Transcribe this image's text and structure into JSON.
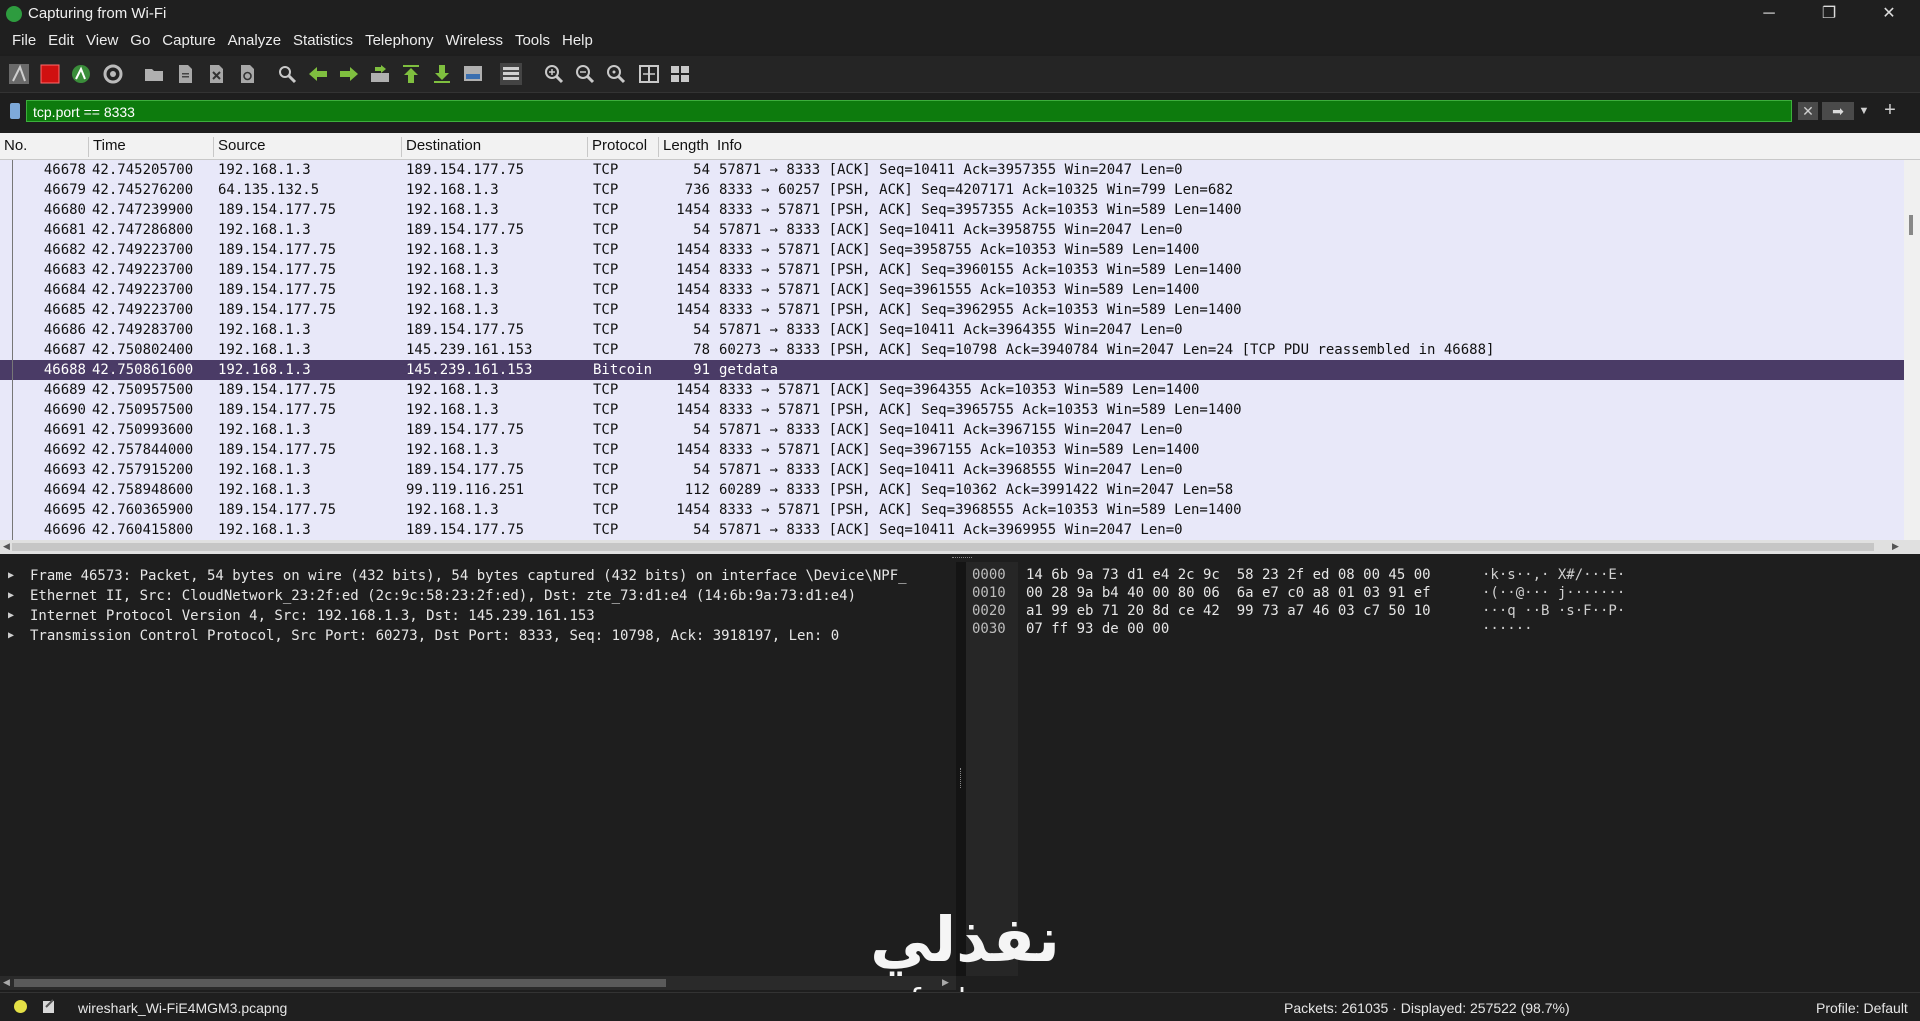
{
  "window": {
    "title": "Capturing from Wi-Fi",
    "minimize": "─",
    "maximize": "❐",
    "close": "✕"
  },
  "menu": [
    "File",
    "Edit",
    "View",
    "Go",
    "Capture",
    "Analyze",
    "Statistics",
    "Telephony",
    "Wireless",
    "Tools",
    "Help"
  ],
  "filter": {
    "value": "tcp.port == 8333",
    "clear": "✕",
    "apply": "➡",
    "dropdown": "▼",
    "add": "+"
  },
  "columns": [
    "No.",
    "Time",
    "Source",
    "Destination",
    "Protocol",
    "Length",
    "Info"
  ],
  "packets": [
    [
      "46678",
      "42.745205700",
      "192.168.1.3",
      "189.154.177.75",
      "TCP",
      "54",
      "57871 → 8333 [ACK] Seq=10411 Ack=3957355 Win=2047 Len=0"
    ],
    [
      "46679",
      "42.745276200",
      "64.135.132.5",
      "192.168.1.3",
      "TCP",
      "736",
      "8333 → 60257 [PSH, ACK] Seq=4207171 Ack=10325 Win=799 Len=682"
    ],
    [
      "46680",
      "42.747239900",
      "189.154.177.75",
      "192.168.1.3",
      "TCP",
      "1454",
      "8333 → 57871 [PSH, ACK] Seq=3957355 Ack=10353 Win=589 Len=1400"
    ],
    [
      "46681",
      "42.747286800",
      "192.168.1.3",
      "189.154.177.75",
      "TCP",
      "54",
      "57871 → 8333 [ACK] Seq=10411 Ack=3958755 Win=2047 Len=0"
    ],
    [
      "46682",
      "42.749223700",
      "189.154.177.75",
      "192.168.1.3",
      "TCP",
      "1454",
      "8333 → 57871 [ACK] Seq=3958755 Ack=10353 Win=589 Len=1400"
    ],
    [
      "46683",
      "42.749223700",
      "189.154.177.75",
      "192.168.1.3",
      "TCP",
      "1454",
      "8333 → 57871 [PSH, ACK] Seq=3960155 Ack=10353 Win=589 Len=1400"
    ],
    [
      "46684",
      "42.749223700",
      "189.154.177.75",
      "192.168.1.3",
      "TCP",
      "1454",
      "8333 → 57871 [ACK] Seq=3961555 Ack=10353 Win=589 Len=1400"
    ],
    [
      "46685",
      "42.749223700",
      "189.154.177.75",
      "192.168.1.3",
      "TCP",
      "1454",
      "8333 → 57871 [PSH, ACK] Seq=3962955 Ack=10353 Win=589 Len=1400"
    ],
    [
      "46686",
      "42.749283700",
      "192.168.1.3",
      "189.154.177.75",
      "TCP",
      "54",
      "57871 → 8333 [ACK] Seq=10411 Ack=3964355 Win=2047 Len=0"
    ],
    [
      "46687",
      "42.750802400",
      "192.168.1.3",
      "145.239.161.153",
      "TCP",
      "78",
      "60273 → 8333 [PSH, ACK] Seq=10798 Ack=3940784 Win=2047 Len=24 [TCP PDU reassembled in 46688]"
    ],
    [
      "46688",
      "42.750861600",
      "192.168.1.3",
      "145.239.161.153",
      "Bitcoin",
      "91",
      "getdata"
    ],
    [
      "46689",
      "42.750957500",
      "189.154.177.75",
      "192.168.1.3",
      "TCP",
      "1454",
      "8333 → 57871 [ACK] Seq=3964355 Ack=10353 Win=589 Len=1400"
    ],
    [
      "46690",
      "42.750957500",
      "189.154.177.75",
      "192.168.1.3",
      "TCP",
      "1454",
      "8333 → 57871 [PSH, ACK] Seq=3965755 Ack=10353 Win=589 Len=1400"
    ],
    [
      "46691",
      "42.750993600",
      "192.168.1.3",
      "189.154.177.75",
      "TCP",
      "54",
      "57871 → 8333 [ACK] Seq=10411 Ack=3967155 Win=2047 Len=0"
    ],
    [
      "46692",
      "42.757844000",
      "189.154.177.75",
      "192.168.1.3",
      "TCP",
      "1454",
      "8333 → 57871 [ACK] Seq=3967155 Ack=10353 Win=589 Len=1400"
    ],
    [
      "46693",
      "42.757915200",
      "192.168.1.3",
      "189.154.177.75",
      "TCP",
      "54",
      "57871 → 8333 [ACK] Seq=10411 Ack=3968555 Win=2047 Len=0"
    ],
    [
      "46694",
      "42.758948600",
      "192.168.1.3",
      "99.119.116.251",
      "TCP",
      "112",
      "60289 → 8333 [PSH, ACK] Seq=10362 Ack=3991422 Win=2047 Len=58"
    ],
    [
      "46695",
      "42.760365900",
      "189.154.177.75",
      "192.168.1.3",
      "TCP",
      "1454",
      "8333 → 57871 [PSH, ACK] Seq=3968555 Ack=10353 Win=589 Len=1400"
    ],
    [
      "46696",
      "42.760415800",
      "192.168.1.3",
      "189.154.177.75",
      "TCP",
      "54",
      "57871 → 8333 [ACK] Seq=10411 Ack=3969955 Win=2047 Len=0"
    ]
  ],
  "selected_packet": "46688",
  "details": [
    "Frame 46573: Packet, 54 bytes on wire (432 bits), 54 bytes captured (432 bits) on interface \\Device\\NPF_",
    "Ethernet II, Src: CloudNetwork_23:2f:ed (2c:9c:58:23:2f:ed), Dst: zte_73:d1:e4 (14:6b:9a:73:d1:e4)",
    "Internet Protocol Version 4, Src: 192.168.1.3, Dst: 145.239.161.153",
    "Transmission Control Protocol, Src Port: 60273, Dst Port: 8333, Seq: 10798, Ack: 3918197, Len: 0"
  ],
  "bytes": [
    {
      "offset": "0000",
      "hex": "14 6b 9a 73 d1 e4 2c 9c  58 23 2f ed 08 00 45 00",
      "ascii": "·k·s··,· X#/···E·"
    },
    {
      "offset": "0010",
      "hex": "00 28 9a b4 40 00 80 06  6a e7 c0 a8 01 03 91 ef",
      "ascii": "·(··@··· j·······"
    },
    {
      "offset": "0020",
      "hex": "a1 99 eb 71 20 8d ce 42  99 73 a7 46 03 c7 50 10",
      "ascii": "···q ··B ·s·F··P·"
    },
    {
      "offset": "0030",
      "hex": "07 ff 93 de 00 00",
      "ascii": "······"
    }
  ],
  "watermark": {
    "arabic": "نفذلي",
    "latin": "nafezly.com"
  },
  "status": {
    "file": "wireshark_Wi-FiE4MGM3.pcapng",
    "packets": "Packets: 261035 · Displayed: 257522 (98.7%)",
    "profile": "Profile: Default"
  },
  "colors": {
    "filter_valid": "#0d7b0d",
    "row_bg": "#e8e8f9",
    "row_selected": "#4a3b66",
    "stop_button": "#d01010",
    "start_button": "#3a8d3a"
  },
  "toolbar_icons": [
    "start-capture-icon",
    "stop-capture-icon",
    "restart-capture-icon",
    "capture-options-icon",
    "open-file-icon",
    "save-file-icon",
    "close-file-icon",
    "reload-file-icon",
    "find-packet-icon",
    "go-back-icon",
    "go-forward-icon",
    "go-to-packet-icon",
    "first-packet-icon",
    "last-packet-icon",
    "autoscroll-icon",
    "colorize-icon",
    "zoom-in-icon",
    "zoom-out-icon",
    "normal-size-icon",
    "resize-columns-icon",
    "layout-icon"
  ]
}
